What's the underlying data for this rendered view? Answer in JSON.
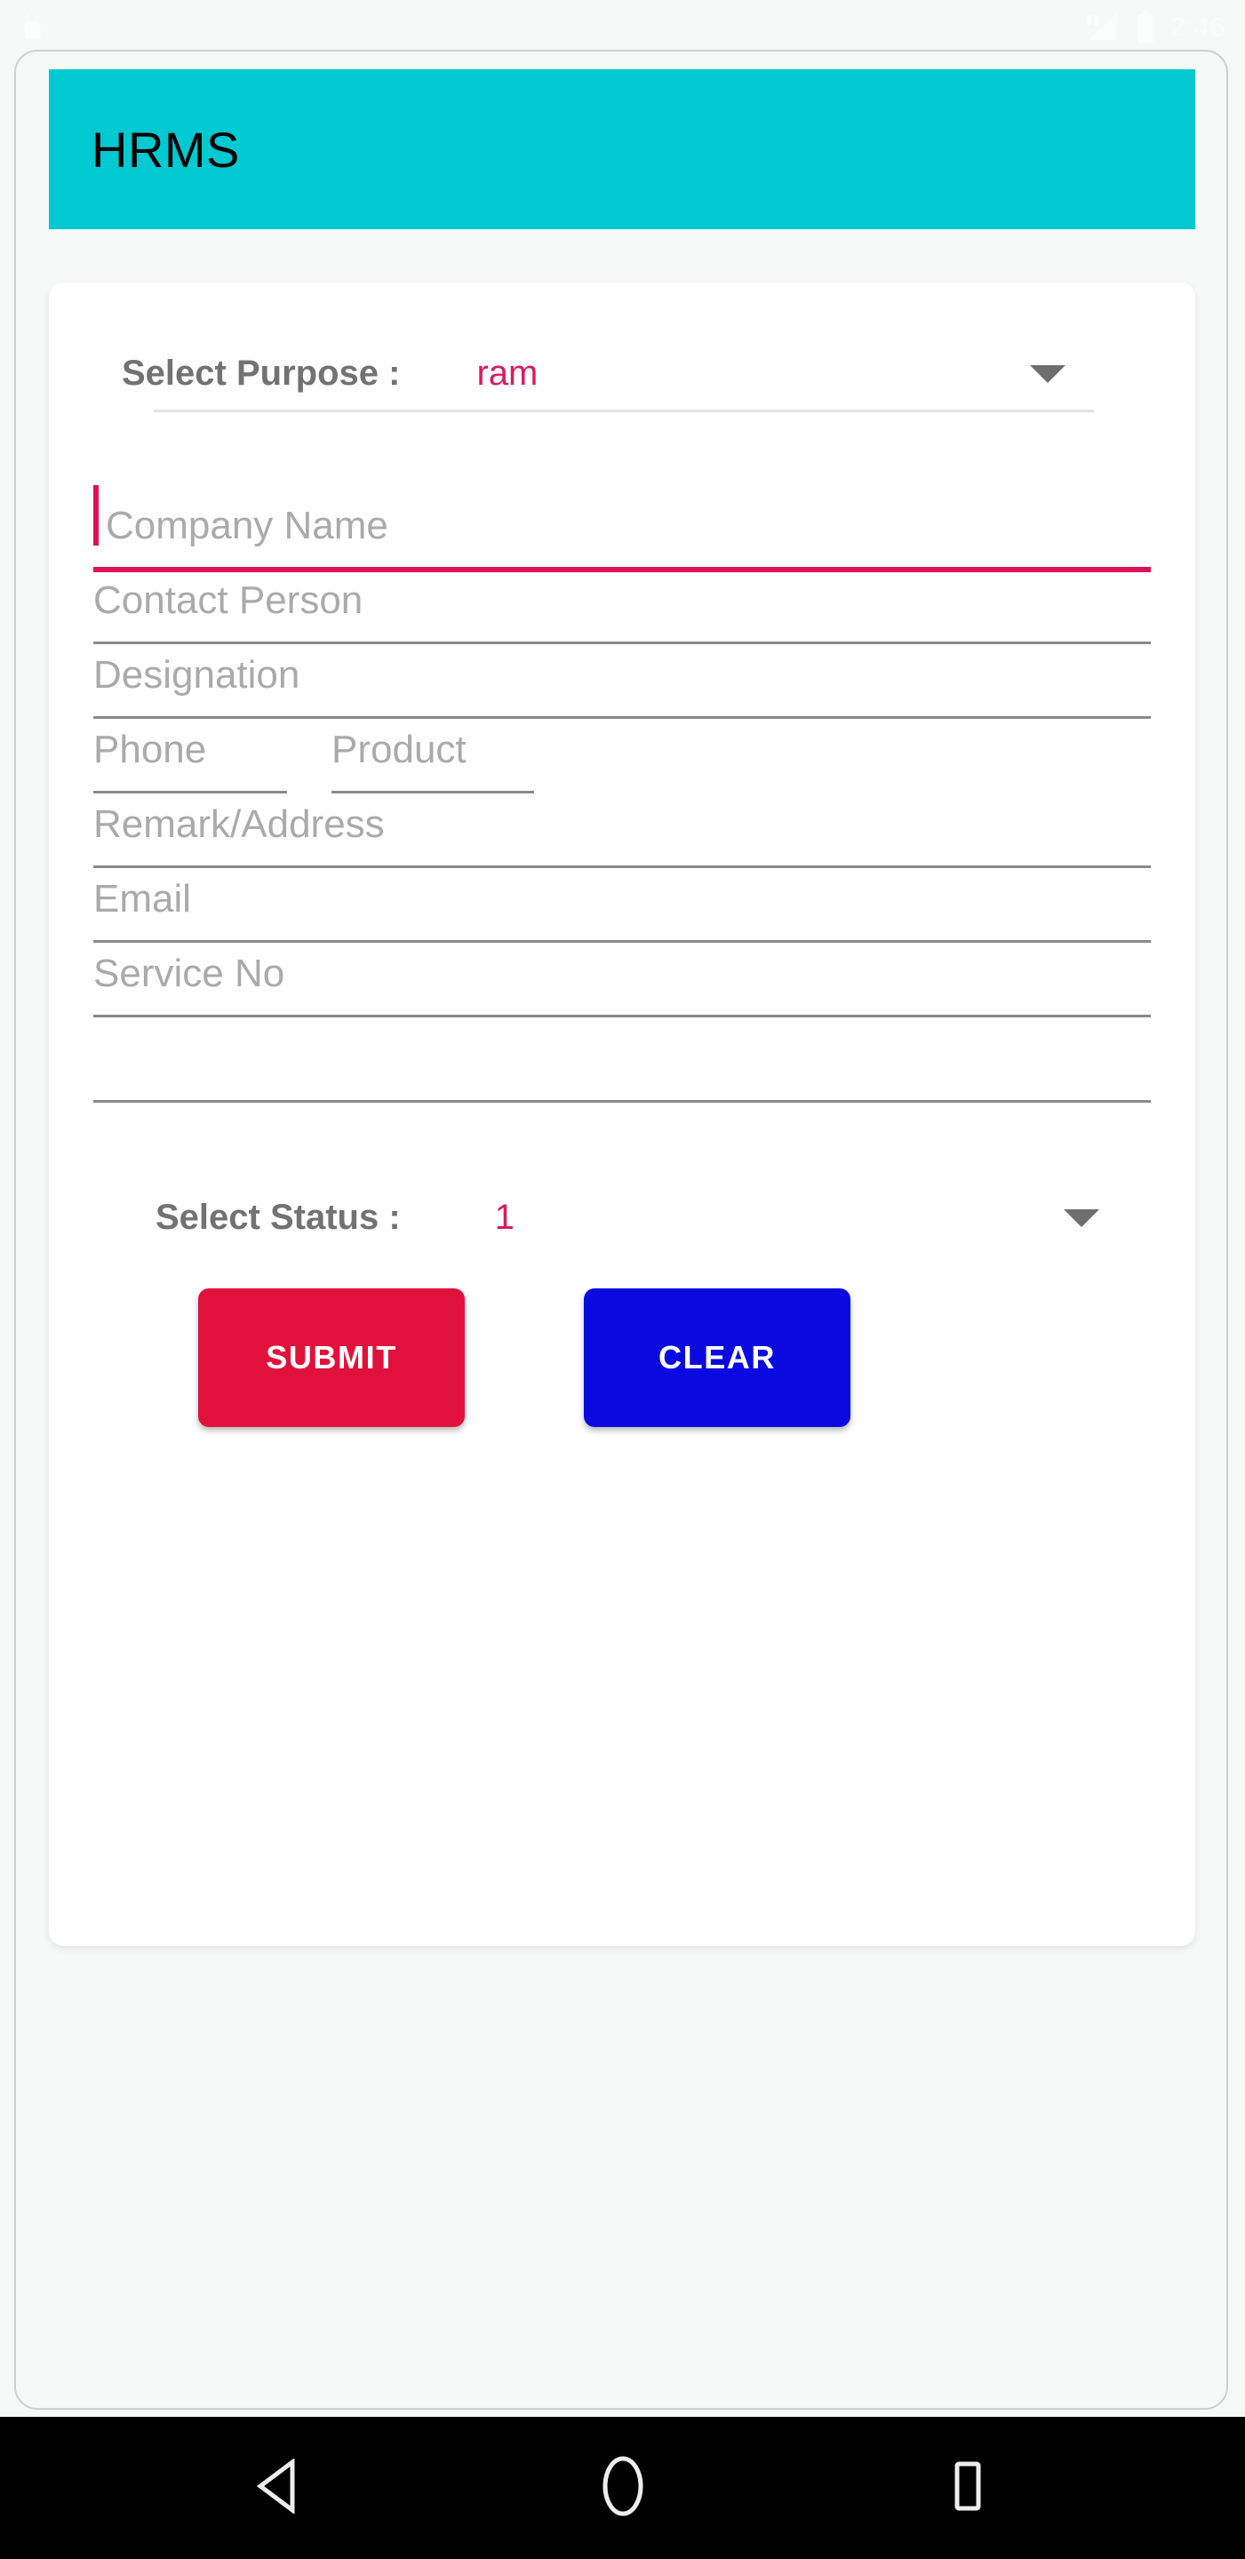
{
  "status_bar": {
    "notification_icon": "android-notification-icon",
    "signal_icon": "signal-bars-icon",
    "battery_icon": "battery-icon",
    "time": "2:46"
  },
  "app_bar": {
    "title": "HRMS",
    "background_color": "#00c9d2",
    "title_color": "#000000"
  },
  "form": {
    "purpose_spinner": {
      "label": "Select Purpose :",
      "value": "ram",
      "caret_icon": "chevron-down-icon"
    },
    "fields": [
      {
        "name": "company-name",
        "placeholder": "Company Name",
        "value": "",
        "focused": true
      },
      {
        "name": "contact-person",
        "placeholder": "Contact Person",
        "value": "",
        "focused": false
      },
      {
        "name": "designation",
        "placeholder": "Designation",
        "value": "",
        "focused": false
      },
      {
        "name": "phone",
        "placeholder": "Phone",
        "value": "",
        "focused": false
      },
      {
        "name": "product",
        "placeholder": "Product",
        "value": "",
        "focused": false
      },
      {
        "name": "remark-address",
        "placeholder": "Remark/Address",
        "value": "",
        "focused": false
      },
      {
        "name": "email",
        "placeholder": "Email",
        "value": "",
        "focused": false
      },
      {
        "name": "service-no",
        "placeholder": "Service No",
        "value": "",
        "focused": false
      },
      {
        "name": "extra-field",
        "placeholder": "",
        "value": "",
        "focused": false
      }
    ],
    "status_spinner": {
      "label": "Select Status :",
      "value": "1",
      "caret_icon": "chevron-down-icon"
    },
    "buttons": {
      "submit": {
        "label": "SUBMIT",
        "color": "#e0123c"
      },
      "clear": {
        "label": "CLEAR",
        "color": "#0a0ae0"
      }
    }
  },
  "nav_bar": {
    "back_icon": "back-triangle-icon",
    "home_icon": "home-circle-icon",
    "recents_icon": "recents-square-icon"
  },
  "colors": {
    "accent": "#dd1155",
    "primary": "#00c9d2",
    "placeholder": "#aaaaaa",
    "label": "#727272"
  }
}
